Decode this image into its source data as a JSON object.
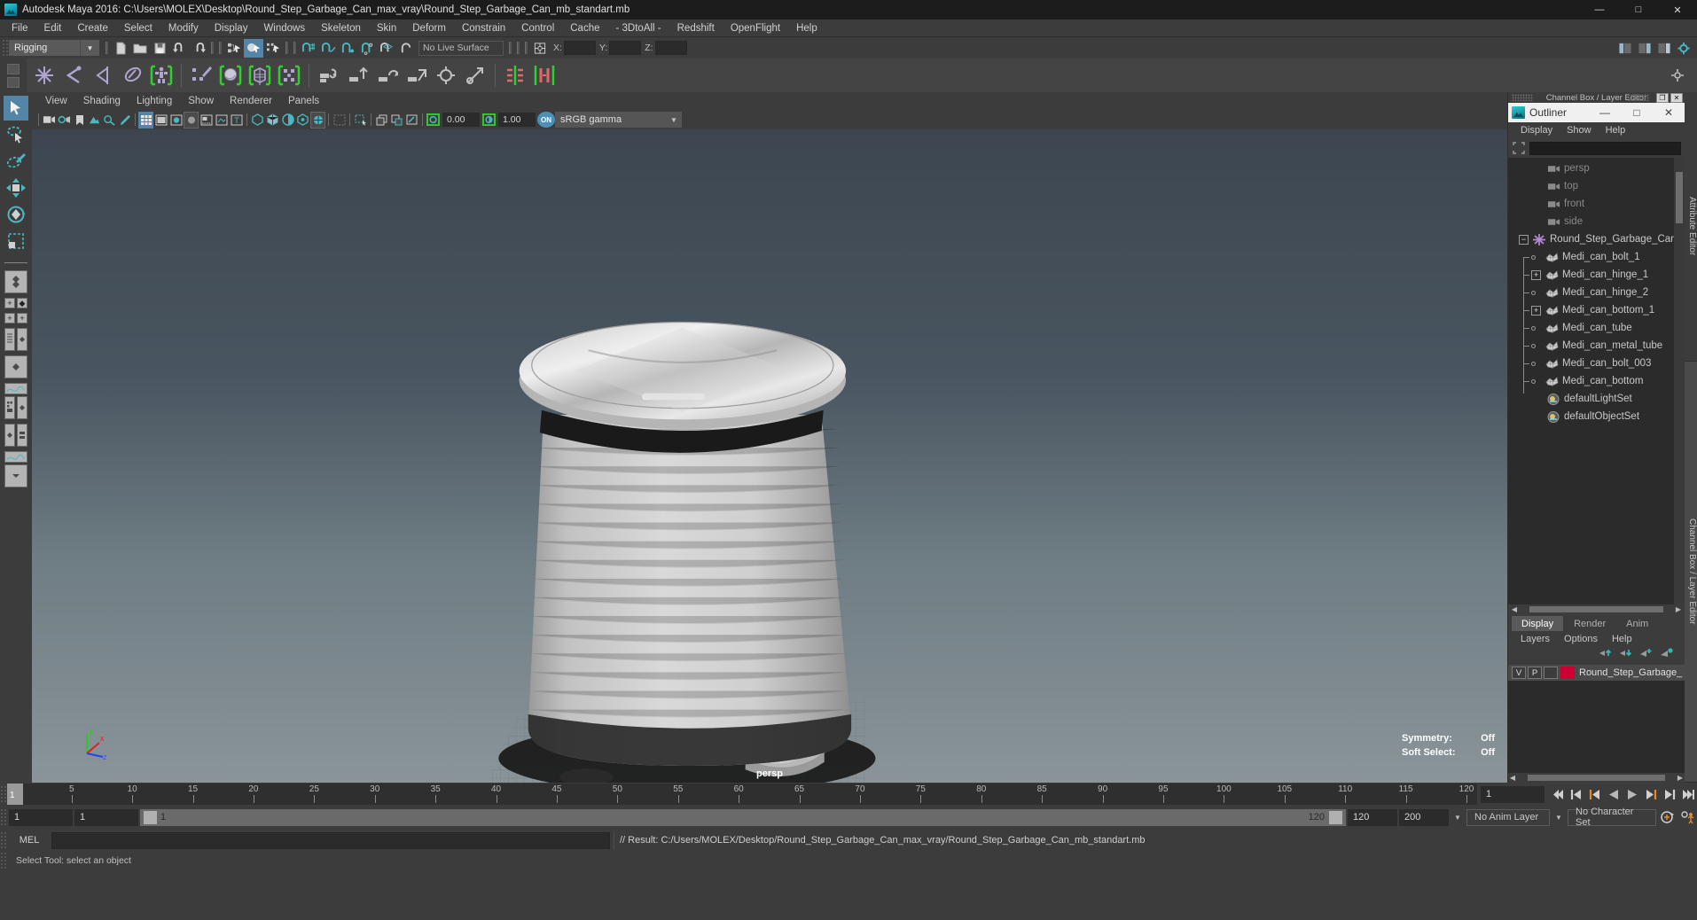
{
  "titlebar": {
    "title": "Autodesk Maya 2016: C:\\Users\\MOLEX\\Desktop\\Round_Step_Garbage_Can_max_vray\\Round_Step_Garbage_Can_mb_standart.mb",
    "minimize": "—",
    "maximize": "□",
    "close": "✕"
  },
  "menubar": {
    "items": [
      "File",
      "Edit",
      "Create",
      "Select",
      "Modify",
      "Display",
      "Windows",
      "Skeleton",
      "Skin",
      "Deform",
      "Constrain",
      "Control",
      "Cache",
      "- 3DtoAll -",
      "Redshift",
      "OpenFlight",
      "Help"
    ]
  },
  "statusline": {
    "menu_set": "Rigging",
    "live_surface": "No Live Surface",
    "x_label": "X:",
    "y_label": "Y:",
    "z_label": "Z:",
    "x_value": "",
    "y_value": "",
    "z_value": ""
  },
  "viewport_menu": {
    "items": [
      "View",
      "Shading",
      "Lighting",
      "Show",
      "Renderer",
      "Panels"
    ]
  },
  "viewport_toolbar": {
    "exposure": "0.00",
    "gamma": "1.00",
    "view_transform": "sRGB gamma",
    "view_transform_toggle": "ON"
  },
  "viewport": {
    "camera_label": "persp",
    "axis_x": "x",
    "axis_y": "y",
    "axis_z": "z",
    "hud": [
      {
        "label": "Symmetry:",
        "value": "Off"
      },
      {
        "label": "Soft Select:",
        "value": "Off"
      }
    ]
  },
  "channelbox_bar": {
    "title": "Channel Box / Layer Editor",
    "restore": "❐",
    "close": "✕"
  },
  "outliner": {
    "title": "Outliner",
    "minimize": "—",
    "maximize": "□",
    "close": "✕",
    "menu": [
      "Display",
      "Show",
      "Help"
    ],
    "search_value": "",
    "items": [
      {
        "label": "persp",
        "depth": 1,
        "toggle": "none",
        "icon": "camera-icon",
        "dim": true
      },
      {
        "label": "top",
        "depth": 1,
        "toggle": "none",
        "icon": "camera-icon",
        "dim": true
      },
      {
        "label": "front",
        "depth": 1,
        "toggle": "none",
        "icon": "camera-icon",
        "dim": true
      },
      {
        "label": "side",
        "depth": 1,
        "toggle": "none",
        "icon": "camera-icon",
        "dim": true
      },
      {
        "label": "Round_Step_Garbage_Can",
        "depth": 0,
        "toggle": "minus",
        "icon": "group-icon",
        "dim": false
      },
      {
        "label": "Medi_can_bolt_1",
        "depth": 1,
        "toggle": "dot",
        "icon": "mesh-icon",
        "dim": false
      },
      {
        "label": "Medi_can_hinge_1",
        "depth": 1,
        "toggle": "plus",
        "icon": "mesh-icon",
        "dim": false
      },
      {
        "label": "Medi_can_hinge_2",
        "depth": 1,
        "toggle": "dot",
        "icon": "mesh-icon",
        "dim": false
      },
      {
        "label": "Medi_can_bottom_1",
        "depth": 1,
        "toggle": "plus",
        "icon": "mesh-icon",
        "dim": false
      },
      {
        "label": "Medi_can_tube",
        "depth": 1,
        "toggle": "dot",
        "icon": "mesh-icon",
        "dim": false
      },
      {
        "label": "Medi_can_metal_tube",
        "depth": 1,
        "toggle": "dot",
        "icon": "mesh-icon",
        "dim": false
      },
      {
        "label": "Medi_can_bolt_003",
        "depth": 1,
        "toggle": "dot",
        "icon": "mesh-icon",
        "dim": false
      },
      {
        "label": "Medi_can_bottom",
        "depth": 1,
        "toggle": "dot",
        "icon": "mesh-icon",
        "dim": false
      },
      {
        "label": "defaultLightSet",
        "depth": 1,
        "toggle": "none",
        "icon": "set-icon",
        "dim": false
      },
      {
        "label": "defaultObjectSet",
        "depth": 1,
        "toggle": "none",
        "icon": "set-icon",
        "dim": false
      }
    ]
  },
  "layer_editor": {
    "tabs": [
      "Display",
      "Render",
      "Anim"
    ],
    "active_tab": "Display",
    "menu": [
      "Layers",
      "Options",
      "Help"
    ],
    "layers": [
      {
        "visible": "V",
        "playback": "P",
        "third": "",
        "color": "#cc0033",
        "name": "Round_Step_Garbage_"
      }
    ]
  },
  "vertical_tabs": [
    {
      "label": "Attribute Editor",
      "selected": false
    },
    {
      "label": "Channel Box / Layer Editor",
      "selected": true
    }
  ],
  "timeline": {
    "ticks": [
      5,
      10,
      15,
      20,
      25,
      30,
      35,
      40,
      45,
      50,
      55,
      60,
      65,
      70,
      75,
      80,
      85,
      90,
      95,
      100,
      105,
      110,
      115,
      120
    ],
    "start": 1,
    "end": 120,
    "current_frame_marker": "1",
    "current_frame": "1"
  },
  "range": {
    "anim_start": "1",
    "anim_end": "1",
    "slider_start": "1",
    "slider_end": "120",
    "playback_end": "120",
    "range_end": "200",
    "anim_layer": "No Anim Layer",
    "character_set": "No Character Set"
  },
  "command_line": {
    "label": "MEL",
    "input_value": "",
    "result": "// Result: C:/Users/MOLEX/Desktop/Round_Step_Garbage_Can_max_vray/Round_Step_Garbage_Can_mb_standart.mb"
  },
  "help_line": {
    "text": "Select Tool: select an object"
  },
  "colors": {
    "accent_blue": "#5285a6",
    "accent_orange": "#e08a2e",
    "shelf_purple": "#b0a5d0",
    "teal": "#4ab8c4",
    "layer_red": "#cc0033"
  }
}
